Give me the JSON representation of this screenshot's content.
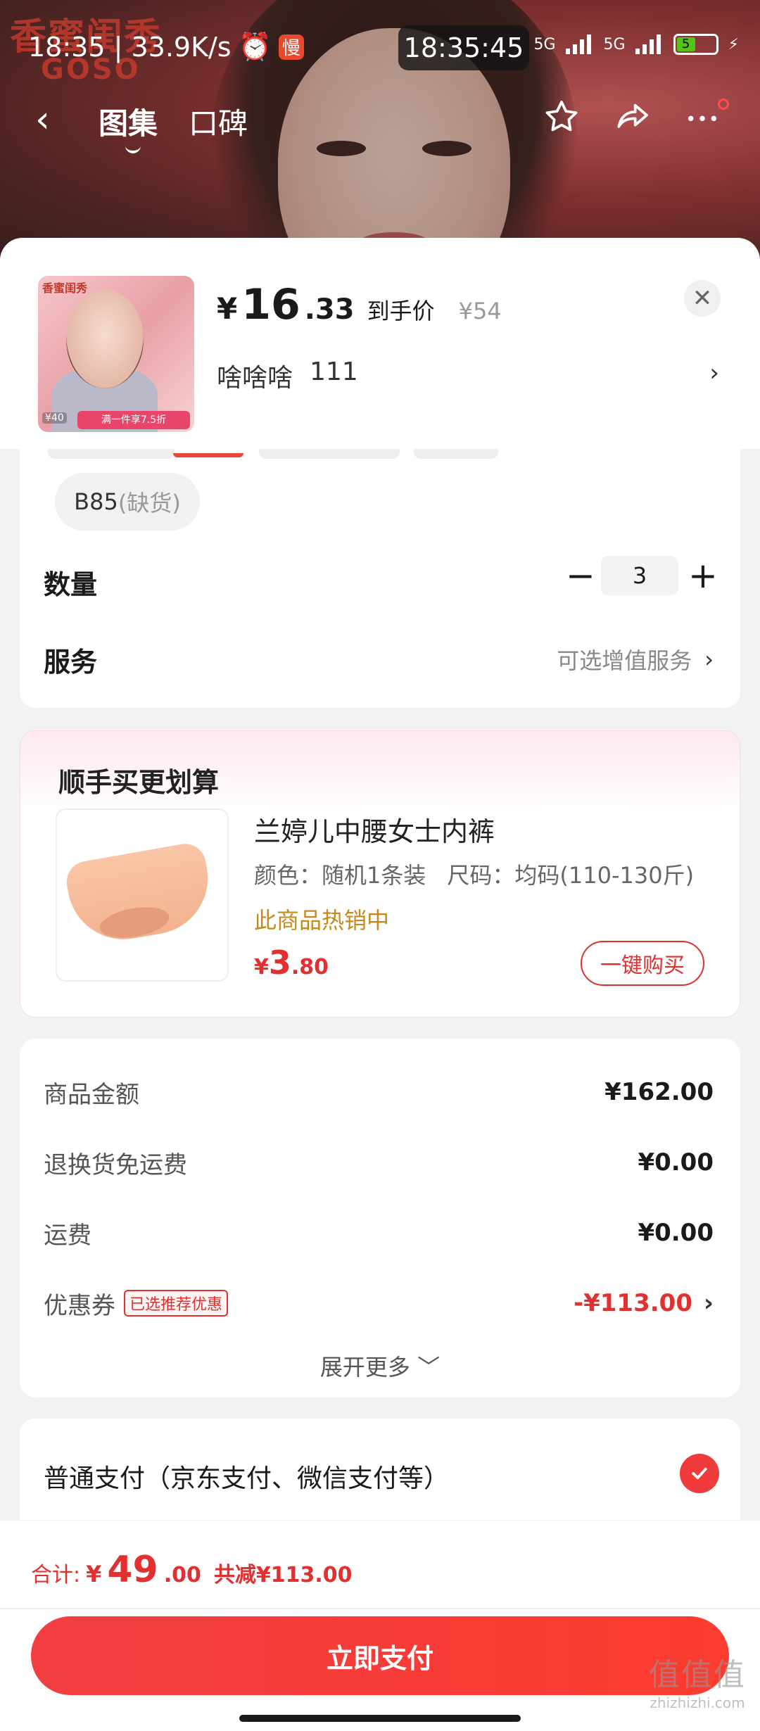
{
  "status_bar": {
    "left_text": "18:35 | 33.9K/s",
    "slow_badge": "慢",
    "time": "18:35:45",
    "network": "5G",
    "battery": "5"
  },
  "hero": {
    "brand_cn": "香蜜闺秀",
    "brand_en": "GOSO"
  },
  "nav": {
    "tab_gallery": "图集",
    "tab_reviews": "口碑"
  },
  "product": {
    "currency": "¥",
    "price_int": "16",
    "price_dec": ".33",
    "price_label": "到手价",
    "original_price": "¥54",
    "spec_name": "啥啥啥",
    "spec_code": "111",
    "thumb_logo": "香蜜闺秀",
    "thumb_banner": "满一件享7.5折",
    "thumb_badge": "¥40"
  },
  "options": {
    "size_chip": "B85",
    "size_oos": "(缺货)",
    "qty_label": "数量",
    "qty_minus": "−",
    "qty_value": "3",
    "qty_plus": "+",
    "service_label": "服务",
    "service_value": "可选增值服务"
  },
  "upsell": {
    "title": "顺手买更划算",
    "name": "兰婷儿中腰女士内裤",
    "attr_color": "颜色：随机1条装",
    "attr_size": "尺码：均码(110-130斤)",
    "hot": "此商品热销中",
    "price_cur": "¥",
    "price_int": "3",
    "price_dec": ".80",
    "buy_label": "一键购买"
  },
  "amounts": {
    "rows": [
      {
        "label": "商品金额",
        "value": "¥162.00"
      },
      {
        "label": "退换货免运费",
        "value": "¥0.00"
      },
      {
        "label": "运费",
        "value": "¥0.00"
      },
      {
        "label": "优惠券",
        "value": "-¥113.00"
      }
    ],
    "coupon_tag": "已选推荐优惠",
    "more": "展开更多"
  },
  "payment": {
    "method": "普通支付（京东支付、微信支付等）"
  },
  "footer": {
    "total_label": "合计:",
    "total_cur": "¥",
    "total_int": "49",
    "total_dec": ".00",
    "discount": "共减¥113.00",
    "pay_button": "立即支付"
  },
  "watermark": {
    "big": "值值值",
    "small": "zhizhizhi.com"
  },
  "colors": {
    "accent_red": "#e0302f",
    "check_red": "#ef3b3b",
    "hot_gold": "#c58a1a"
  }
}
